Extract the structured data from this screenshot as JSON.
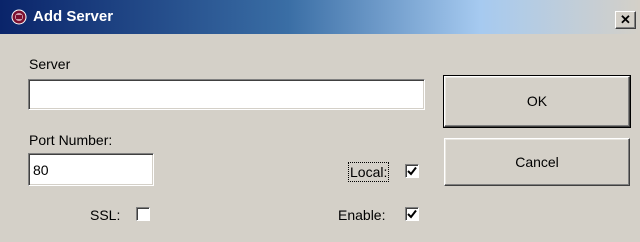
{
  "window": {
    "title": "Add Server",
    "app_icon": "app-logo-icon",
    "close_icon": "close-icon",
    "close_glyph": "✕"
  },
  "form": {
    "server_label": "Server",
    "server_value": "",
    "port_label": "Port Number:",
    "port_value": "80",
    "ssl_label": "SSL:",
    "ssl_checked": false,
    "local_label": "Local:",
    "local_checked": true,
    "enable_label": "Enable:",
    "enable_checked": true
  },
  "buttons": {
    "ok_label": "OK",
    "cancel_label": "Cancel"
  },
  "colors": {
    "face": "#d4d0c8",
    "title_start": "#0a246a",
    "title_end": "#a6caf0"
  }
}
